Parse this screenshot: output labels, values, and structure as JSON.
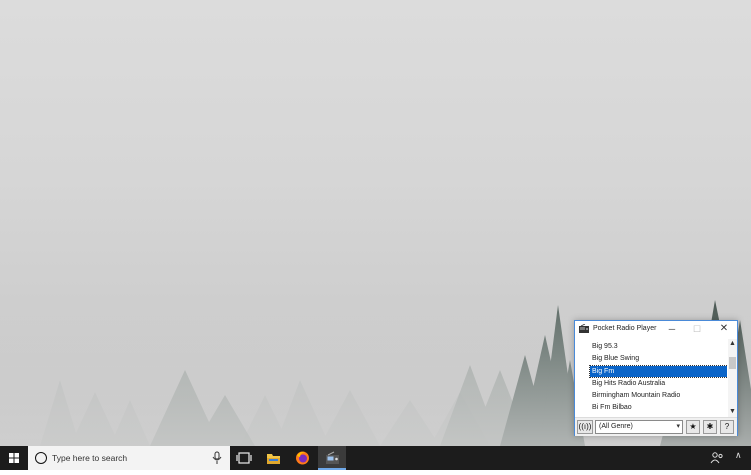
{
  "window": {
    "title": "Pocket Radio Player",
    "controls": {
      "minimize": "─",
      "maximize": "☐",
      "close": "✕"
    }
  },
  "stations": [
    {
      "label": "Big 95.3",
      "selected": false
    },
    {
      "label": "Big Blue Swing",
      "selected": false
    },
    {
      "label": "Big Fm",
      "selected": true
    },
    {
      "label": "Big Hits Radio Australia",
      "selected": false
    },
    {
      "label": "Birmingham Mountain Radio",
      "selected": false
    },
    {
      "label": "Bi Fm Bilbao",
      "selected": false
    }
  ],
  "toolbar": {
    "signal_label": "((ı))",
    "genre_value": "(All Genre)",
    "favorite_label": "★",
    "settings_label": "✱",
    "help_label": "?"
  },
  "scrollbar": {
    "up": "▲",
    "down": "▼"
  },
  "taskbar": {
    "search_placeholder": "Type here to search",
    "accent": "#6fa8e8"
  },
  "colors": {
    "selection": "#0a64c8",
    "window_border": "#4a8ad8",
    "taskbar": "#1c1c1c"
  }
}
